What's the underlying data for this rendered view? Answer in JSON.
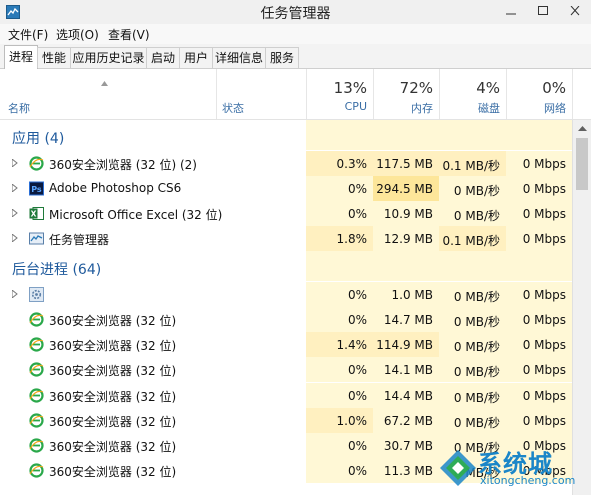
{
  "window": {
    "title": "任务管理器"
  },
  "menu": [
    "文件(F)",
    "选项(O)",
    "查看(V)"
  ],
  "tabs": [
    "进程",
    "性能",
    "应用历史记录",
    "启动",
    "用户",
    "详细信息",
    "服务"
  ],
  "header": {
    "name_label": "名称",
    "status_label": "状态",
    "cpu": {
      "percent": "13%",
      "label": "CPU"
    },
    "memory": {
      "percent": "72%",
      "label": "内存"
    },
    "disk": {
      "percent": "4%",
      "label": "磁盘"
    },
    "network": {
      "percent": "0%",
      "label": "网络"
    }
  },
  "groups": [
    {
      "title": "应用 (4)",
      "rows": [
        {
          "name": "360安全浏览器 (32 位) (2)",
          "icon": "ie-browser-icon",
          "cpu": "0.3%",
          "memory": "117.5 MB",
          "disk": "0.1 MB/秒",
          "network": "0 Mbps"
        },
        {
          "name": "Adobe Photoshop CS6",
          "icon": "photoshop-icon",
          "cpu": "0%",
          "memory": "294.5 MB",
          "disk": "0 MB/秒",
          "network": "0 Mbps"
        },
        {
          "name": "Microsoft Office Excel (32 位)",
          "icon": "excel-icon",
          "cpu": "0%",
          "memory": "10.9 MB",
          "disk": "0 MB/秒",
          "network": "0 Mbps"
        },
        {
          "name": "任务管理器",
          "icon": "task-manager-icon",
          "cpu": "1.8%",
          "memory": "12.9 MB",
          "disk": "0.1 MB/秒",
          "network": "0 Mbps"
        }
      ]
    },
    {
      "title": "后台进程 (64)",
      "rows": [
        {
          "name": "",
          "icon": "gear-service-icon",
          "cpu": "0%",
          "memory": "1.0 MB",
          "disk": "0 MB/秒",
          "network": "0 Mbps"
        },
        {
          "name": "360安全浏览器 (32 位)",
          "icon": "ie-browser-icon",
          "cpu": "0%",
          "memory": "14.7 MB",
          "disk": "0 MB/秒",
          "network": "0 Mbps"
        },
        {
          "name": "360安全浏览器 (32 位)",
          "icon": "ie-browser-icon",
          "cpu": "1.4%",
          "memory": "114.9 MB",
          "disk": "0 MB/秒",
          "network": "0 Mbps"
        },
        {
          "name": "360安全浏览器 (32 位)",
          "icon": "ie-browser-icon",
          "cpu": "0%",
          "memory": "14.1 MB",
          "disk": "0 MB/秒",
          "network": "0 Mbps"
        },
        {
          "name": "360安全浏览器 (32 位)",
          "icon": "ie-browser-icon",
          "cpu": "0%",
          "memory": "14.4 MB",
          "disk": "0 MB/秒",
          "network": "0 Mbps"
        },
        {
          "name": "360安全浏览器 (32 位)",
          "icon": "ie-browser-icon",
          "cpu": "1.0%",
          "memory": "67.2 MB",
          "disk": "0 MB/秒",
          "network": "0 Mbps"
        },
        {
          "name": "360安全浏览器 (32 位)",
          "icon": "ie-browser-icon",
          "cpu": "0%",
          "memory": "30.7 MB",
          "disk": "0 MB/秒",
          "network": "0 Mbps"
        },
        {
          "name": "360安全浏览器 (32 位)",
          "icon": "ie-browser-icon",
          "cpu": "0%",
          "memory": "11.3 MB",
          "disk": "0 MB/秒",
          "network": "0 Mbps"
        }
      ]
    }
  ],
  "watermark": {
    "text": "系统城",
    "url": "xitongcheng.com"
  },
  "colors": {
    "heat_light": "#fff8d6",
    "heat_mid": "#fff0c0",
    "heat_strong": "#fde69a",
    "group_title": "#1f5a9c",
    "watermark": "#1b86c8"
  }
}
